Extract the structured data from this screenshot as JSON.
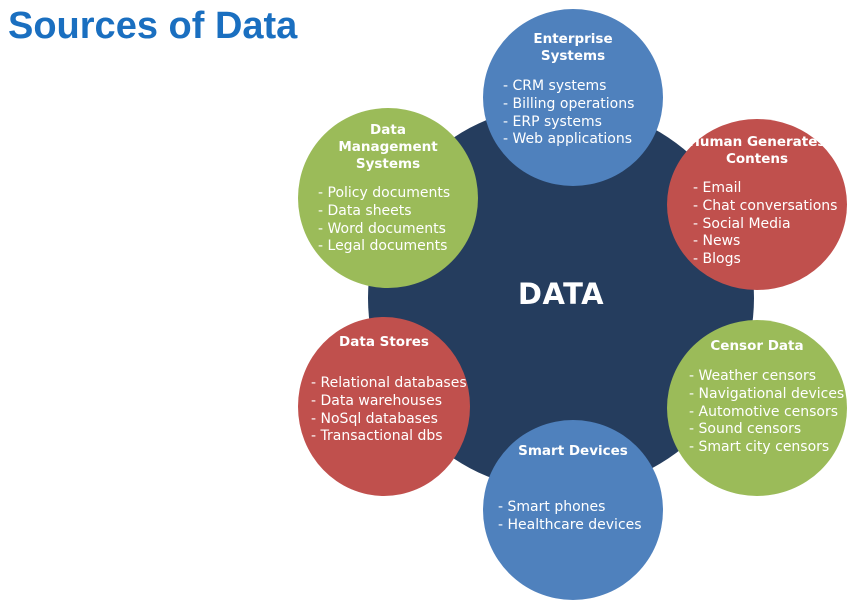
{
  "title": "Sources of Data",
  "hub": {
    "label": "DATA",
    "color": "#253d5e"
  },
  "colors": {
    "blue": "#4f81bd",
    "red": "#c0504d",
    "green": "#9bbb59"
  },
  "nodes": [
    {
      "id": "n-enterprise",
      "color": "#4f81bd",
      "title": "Enterprise\nSystems",
      "items": [
        "CRM systems",
        "Billing operations",
        "ERP systems",
        "Web applications"
      ]
    },
    {
      "id": "n-human",
      "color": "#c0504d",
      "title": "Human Generates\nContens",
      "items": [
        "Email",
        "Chat conversations",
        "Social Media",
        "News",
        "Blogs"
      ]
    },
    {
      "id": "n-datamgmt",
      "color": "#9bbb59",
      "title": "Data\nManagement\nSystems",
      "items": [
        "Policy documents",
        "Data sheets",
        "Word documents",
        "Legal documents"
      ]
    },
    {
      "id": "n-stores",
      "color": "#c0504d",
      "title": "Data Stores",
      "items": [
        "Relational databases",
        "Data warehouses",
        "NoSql databases",
        "Transactional dbs"
      ]
    },
    {
      "id": "n-censor",
      "color": "#9bbb59",
      "title": "Censor Data",
      "items": [
        "Weather censors",
        "Navigational devices",
        "Automotive censors",
        "Sound censors",
        "Smart city censors"
      ]
    },
    {
      "id": "n-smart",
      "color": "#4f81bd",
      "title": "Smart Devices",
      "items": [
        "Smart phones",
        "Healthcare devices"
      ]
    }
  ]
}
